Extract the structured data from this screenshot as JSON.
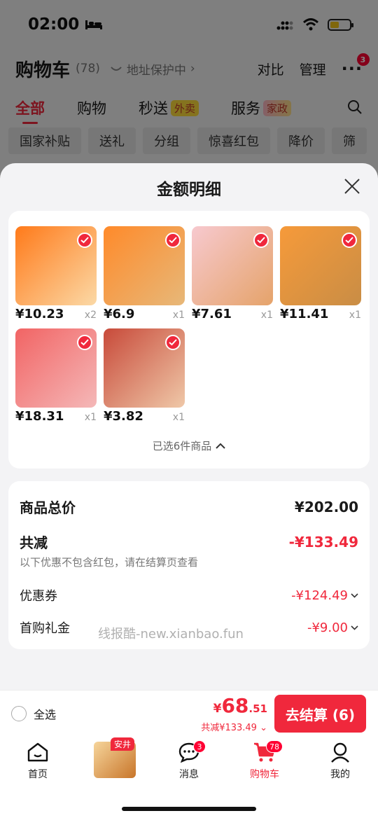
{
  "status_bar": {
    "time": "02:00"
  },
  "header": {
    "title": "购物车",
    "count": "(78)",
    "address_protect": "地址保护中",
    "compare": "对比",
    "manage": "管理",
    "more_badge": "3"
  },
  "tabs": [
    {
      "label": "全部",
      "tag": ""
    },
    {
      "label": "购物",
      "tag": ""
    },
    {
      "label": "秒送",
      "tag": "外卖"
    },
    {
      "label": "服务",
      "tag": "家政"
    }
  ],
  "chips": [
    "国家补贴",
    "送礼",
    "分组",
    "惊喜红包",
    "降价",
    "筛"
  ],
  "sheet": {
    "title": "金额明细",
    "products": [
      {
        "price": "¥10.23",
        "qty": "x2",
        "colors": [
          "#ff7a1a",
          "#fbd9a6"
        ]
      },
      {
        "price": "¥6.9",
        "qty": "x1",
        "colors": [
          "#ff8a2a",
          "#e7b879"
        ]
      },
      {
        "price": "¥7.61",
        "qty": "x1",
        "colors": [
          "#f7c9cf",
          "#e5a36a"
        ]
      },
      {
        "price": "¥11.41",
        "qty": "x1",
        "colors": [
          "#f69a3a",
          "#c98d45"
        ]
      },
      {
        "price": "¥18.31",
        "qty": "x1",
        "colors": [
          "#f26464",
          "#f4b8b8"
        ]
      },
      {
        "price": "¥3.82",
        "qty": "x1",
        "colors": [
          "#c84a3a",
          "#efc8a8"
        ]
      }
    ],
    "selected_text": "已选6件商品",
    "summary": {
      "total_label": "商品总价",
      "total_value": "¥202.00",
      "discount_label": "共减",
      "discount_value": "-¥133.49",
      "note": "以下优惠不包含红包，请在结算页查看",
      "coupon_label": "优惠券",
      "coupon_value": "-¥124.49",
      "gift_label": "首购礼金",
      "gift_value": "-¥9.00"
    },
    "watermark": "线报酷-new.xianbao.fun"
  },
  "checkout": {
    "select_all": "全选",
    "yen": "¥",
    "price_int": "68",
    "price_dec": ".51",
    "save_text": "共减¥133.49",
    "button": "去结算 (6)"
  },
  "tabbar": {
    "home": "首页",
    "promo_tag": "安井",
    "messages": "消息",
    "messages_badge": "3",
    "cart": "购物车",
    "cart_badge": "78",
    "mine": "我的"
  },
  "colors": {
    "accent": "#f0283c"
  }
}
